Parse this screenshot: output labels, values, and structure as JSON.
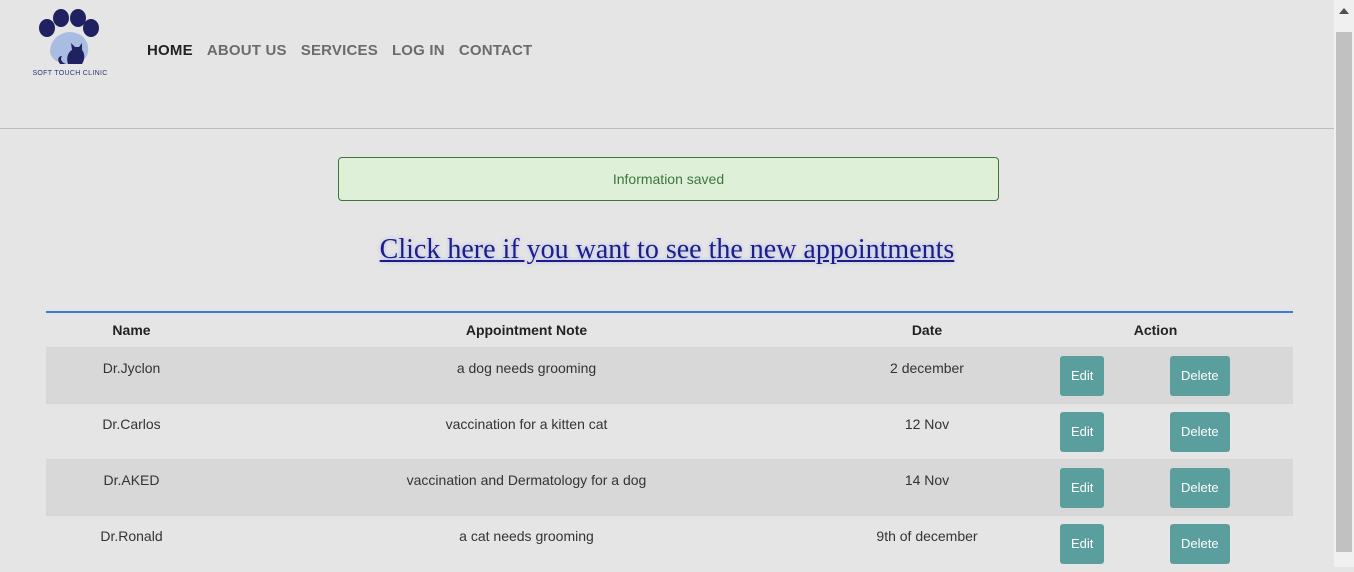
{
  "logo": {
    "text": "SOFT TOUCH CLINIC",
    "icon": "paw-print-cat-icon"
  },
  "nav": {
    "items": [
      {
        "label": "HOME",
        "active": true
      },
      {
        "label": "ABOUT US",
        "active": false
      },
      {
        "label": "SERVICES",
        "active": false
      },
      {
        "label": "LOG IN",
        "active": false
      },
      {
        "label": "CONTACT",
        "active": false
      }
    ]
  },
  "alert": {
    "message": "Information saved"
  },
  "link": {
    "text": "Click here if you want to see the new appointments"
  },
  "table": {
    "headers": [
      "Name",
      "Appointment Note",
      "Date",
      "Action"
    ],
    "rows": [
      {
        "name": "Dr.Jyclon",
        "note": "a dog needs grooming",
        "date": "2 december",
        "edit": "Edit",
        "delete": "Delete"
      },
      {
        "name": "Dr.Carlos",
        "note": "vaccination for a kitten cat",
        "date": "12 Nov",
        "edit": "Edit",
        "delete": "Delete"
      },
      {
        "name": "Dr.AKED",
        "note": "vaccination and Dermatology for a dog",
        "date": "14 Nov",
        "edit": "Edit",
        "delete": "Delete"
      },
      {
        "name": "Dr.Ronald",
        "note": "a cat needs grooming",
        "date": "9th of december",
        "edit": "Edit",
        "delete": "Delete"
      }
    ]
  },
  "colors": {
    "background": "#e6e5e6",
    "alert_bg": "#dff0d8",
    "alert_text": "#3c763d",
    "link": "#1d1c8a",
    "button": "#5a9e9d",
    "table_rule": "#3b7bd6"
  }
}
